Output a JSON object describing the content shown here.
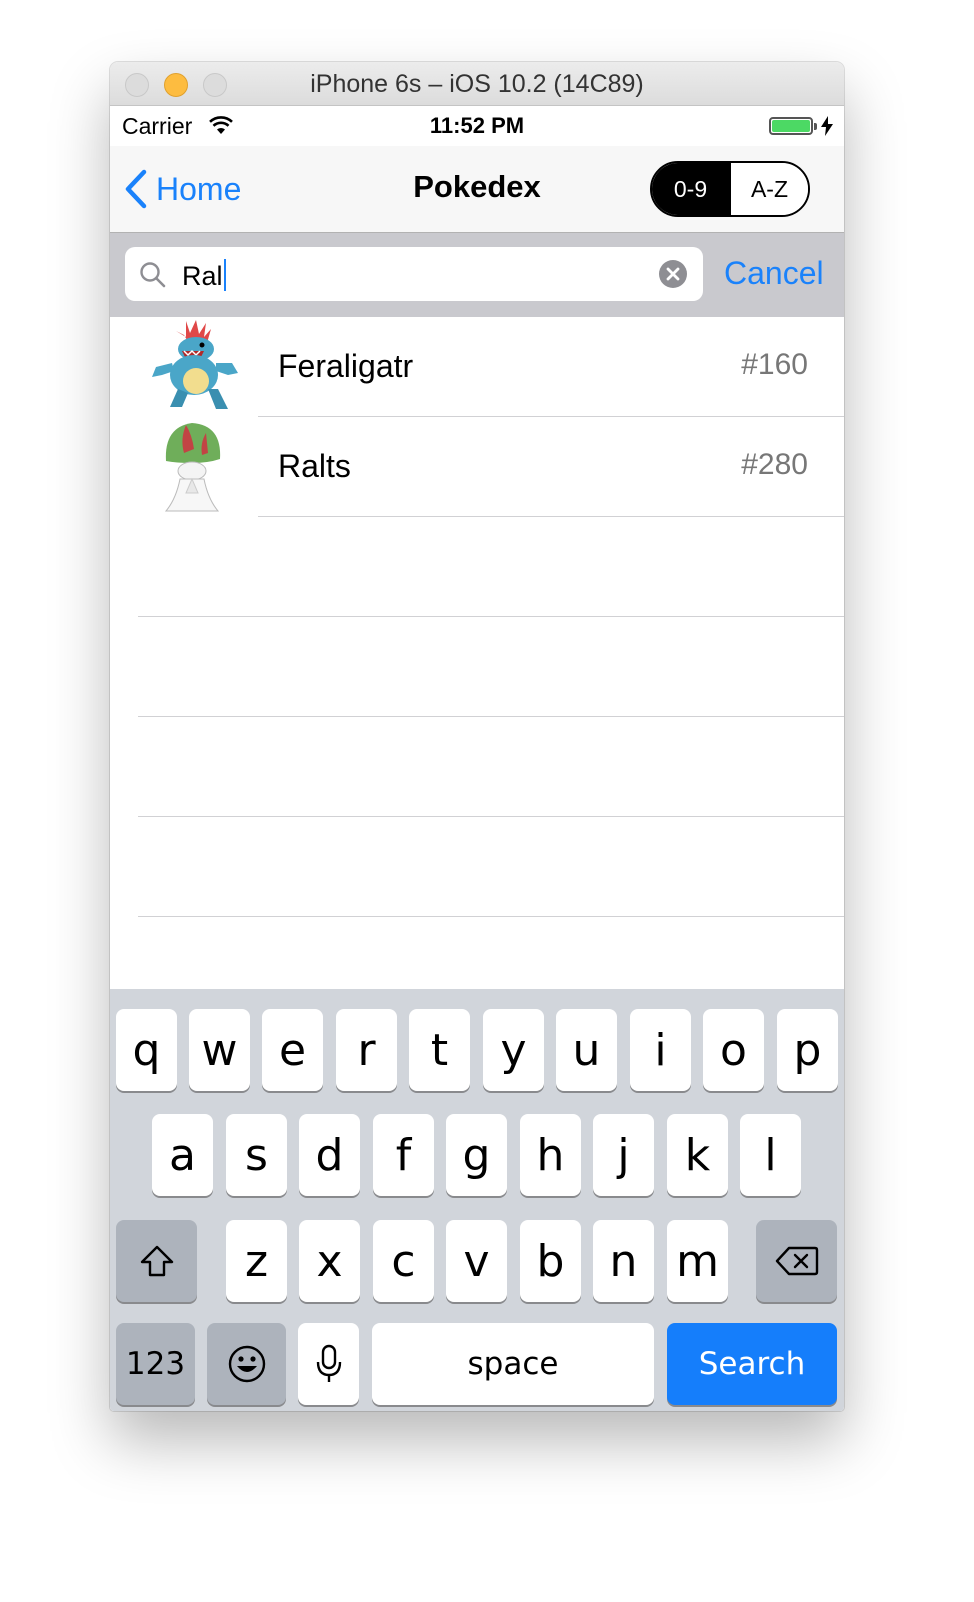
{
  "window": {
    "title": "iPhone 6s – iOS 10.2 (14C89)"
  },
  "status_bar": {
    "carrier": "Carrier",
    "time": "11:52 PM"
  },
  "navbar": {
    "back_label": "Home",
    "title": "Pokedex",
    "segments": [
      {
        "label": "0-9",
        "selected": true
      },
      {
        "label": "A-Z",
        "selected": false
      }
    ]
  },
  "search": {
    "value": "Ral",
    "cancel_label": "Cancel"
  },
  "results": [
    {
      "name": "Feraligatr",
      "number": "#160"
    },
    {
      "name": "Ralts",
      "number": "#280"
    }
  ],
  "keyboard": {
    "row1": [
      "q",
      "w",
      "e",
      "r",
      "t",
      "y",
      "u",
      "i",
      "o",
      "p"
    ],
    "row2": [
      "a",
      "s",
      "d",
      "f",
      "g",
      "h",
      "j",
      "k",
      "l"
    ],
    "row3": [
      "z",
      "x",
      "c",
      "v",
      "b",
      "n",
      "m"
    ],
    "numbers_label": "123",
    "space_label": "space",
    "return_label": "Search"
  },
  "colors": {
    "accent": "#1a82fb",
    "return_key": "#157efb",
    "battery": "#4cd964",
    "keyboard_bg": "#d1d5db"
  },
  "icons": [
    "back-chevron-icon",
    "search-icon",
    "clear-icon",
    "wifi-icon",
    "battery-icon",
    "shift-icon",
    "delete-icon",
    "emoji-icon",
    "microphone-icon"
  ]
}
